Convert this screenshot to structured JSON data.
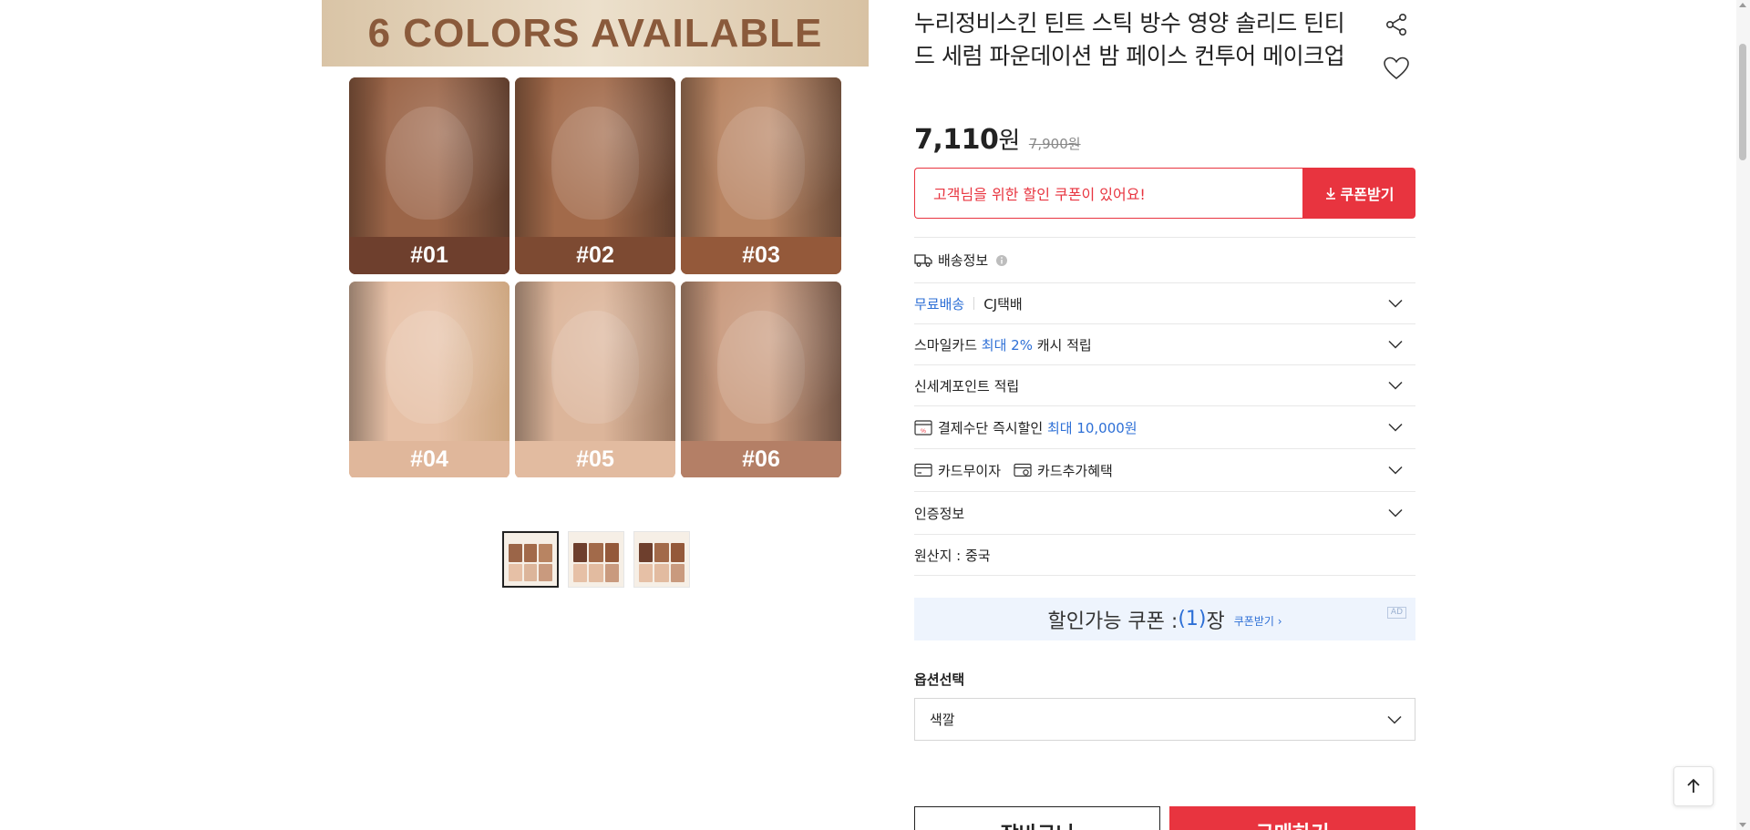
{
  "gallery": {
    "banner_text": "6 COLORS AVAILABLE",
    "swatches": [
      {
        "label": "#01",
        "face_color": "#9b6548",
        "bar_color": "#6e3f2d",
        "hair_color": "#2a1a14"
      },
      {
        "label": "#02",
        "face_color": "#a26a4a",
        "bar_color": "#7d4a32",
        "hair_color": "#2b1b15"
      },
      {
        "label": "#03",
        "face_color": "#b88462",
        "bar_color": "#94593a",
        "hair_color": "#2d1d16"
      },
      {
        "label": "#04",
        "face_color": "#e6c0a6",
        "bar_color": "#e0b79b",
        "hair_color": "#b89060"
      },
      {
        "label": "#05",
        "face_color": "#dcb59a",
        "bar_color": "#e2bba0",
        "hair_color": "#6b4a35"
      },
      {
        "label": "#06",
        "face_color": "#c99a7e",
        "bar_color": "#b47f66",
        "hair_color": "#2a1b16"
      }
    ],
    "thumbnails": [
      {
        "name": "thumbnail-1",
        "active": true
      },
      {
        "name": "thumbnail-2",
        "active": false
      },
      {
        "name": "thumbnail-3",
        "active": false
      }
    ]
  },
  "product": {
    "title": "누리정비스킨 틴트 스틱 방수 영양 솔리드 틴티드 세럼 파운데이션 밤 페이스 컨투어 메이크업",
    "price": "7,110",
    "price_unit": "원",
    "original_price": "7,900원",
    "share_icon": "share-icon",
    "wish_icon": "heart-icon"
  },
  "coupon": {
    "message": "고객님을 위한 할인 쿠폰이 있어요!",
    "button_label": "쿠폰받기"
  },
  "rows": {
    "shipping_title": "배송정보",
    "free_shipping": "무료배송",
    "carrier": "CJ택배",
    "smilecard_prefix": "스마일카드",
    "smilecard_highlight": "최대 2%",
    "smilecard_suffix": "캐시 적립",
    "shinsegae_point": "신세계포인트 적립",
    "payment_discount": "결제수단 즉시할인",
    "payment_discount_highlight": "최대 10,000원",
    "card_installment": "카드무이자",
    "card_benefit": "카드추가혜택",
    "certification": "인증정보",
    "origin": "원산지 : 중국"
  },
  "coupon_bar": {
    "text_prefix": "할인가능 쿠폰 : ",
    "count": "(1)",
    "text_suffix": "장",
    "get_link": "쿠폰받기 ›",
    "ad_label": "AD"
  },
  "options": {
    "title": "옵션선택",
    "select_label": "색깔"
  },
  "actions": {
    "cart_label": "장바구니",
    "buy_label": "구매하기"
  },
  "colors": {
    "accent_red": "#e8343f",
    "link_blue": "#2d6fd6"
  }
}
